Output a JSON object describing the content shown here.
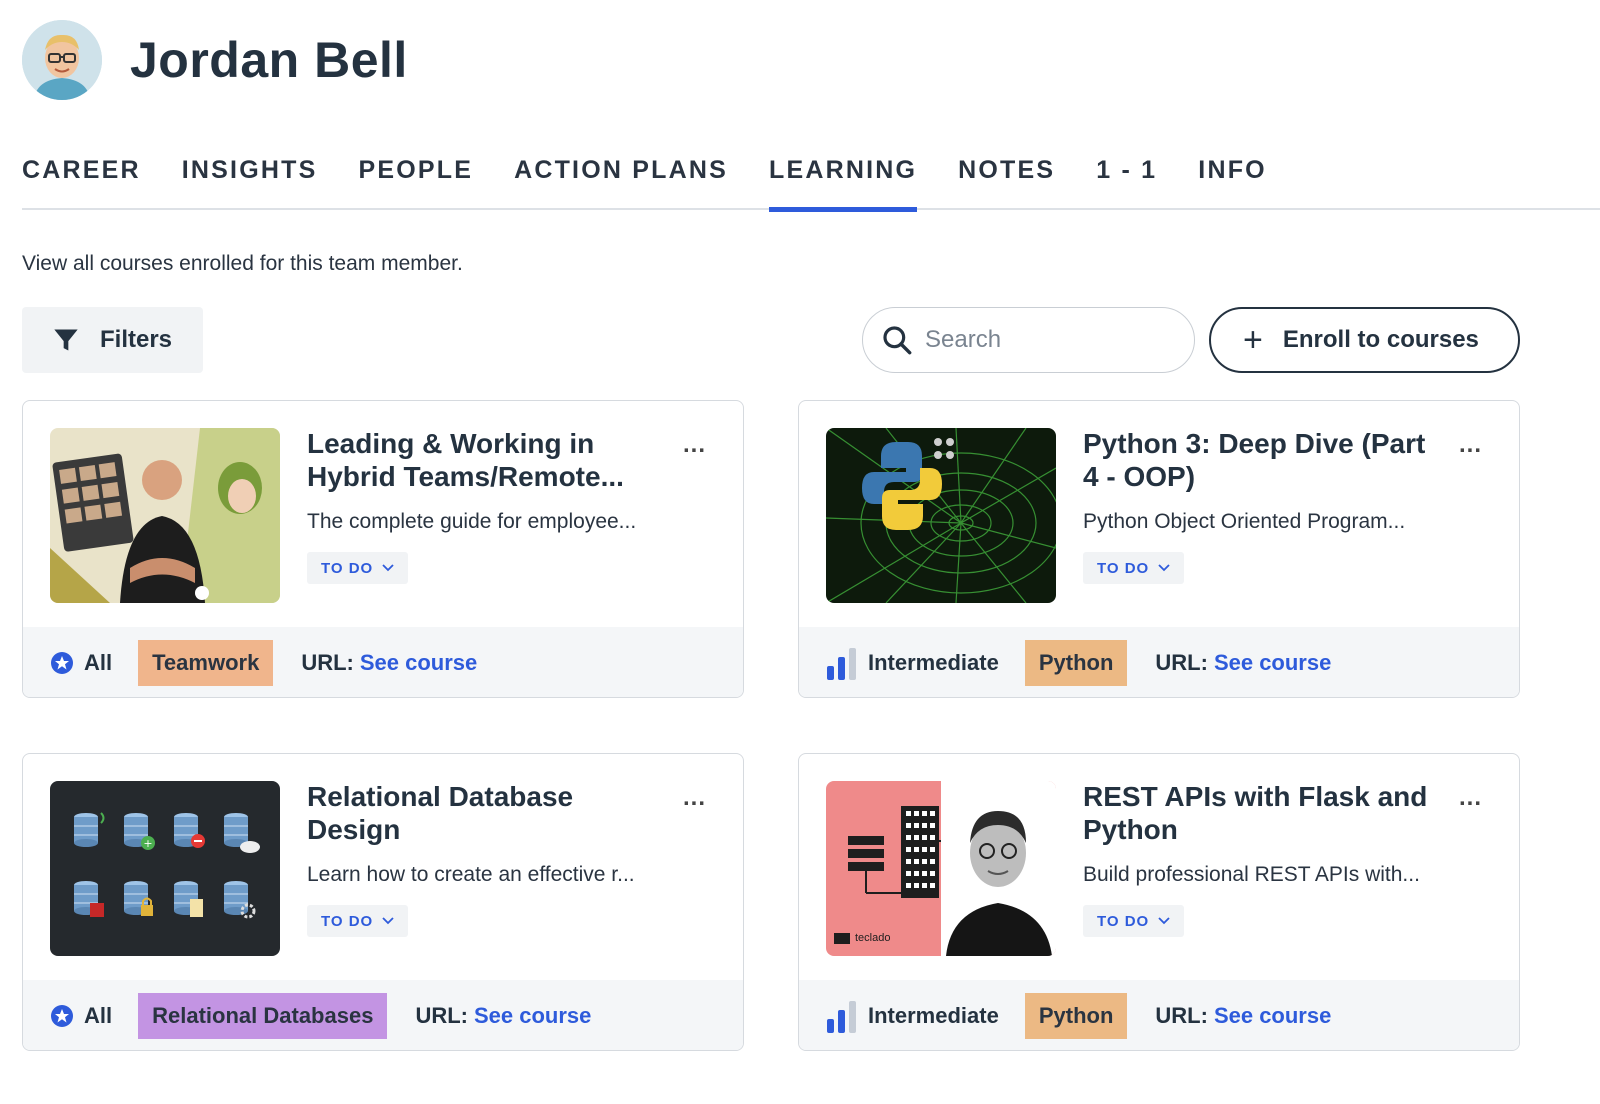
{
  "profile": {
    "name": "Jordan Bell"
  },
  "tabs": [
    {
      "label": "CAREER"
    },
    {
      "label": "INSIGHTS"
    },
    {
      "label": "PEOPLE"
    },
    {
      "label": "ACTION PLANS"
    },
    {
      "label": "LEARNING",
      "active": true
    },
    {
      "label": "NOTES"
    },
    {
      "label": "1 - 1"
    },
    {
      "label": "INFO"
    }
  ],
  "learning": {
    "description": "View all courses enrolled for this team member.",
    "filters_label": "Filters",
    "search_placeholder": "Search",
    "enroll_label": "Enroll to courses"
  },
  "colors": {
    "accent": "#2e5bdb",
    "tag_teamwork": "#f0b58c",
    "tag_python": "#ecb984",
    "tag_relational": "#c394e3"
  },
  "courses": [
    {
      "title": "Leading & Working in Hybrid Teams/Remote...",
      "subtitle": "The complete guide for employee...",
      "status": "TO DO",
      "level": "All",
      "level_icon": "star-badge-icon",
      "tag": "Teamwork",
      "url_label": "URL:",
      "url_text": "See course",
      "more": "..."
    },
    {
      "title": "Python 3: Deep Dive (Part 4 - OOP)",
      "subtitle": "Python Object Oriented Program...",
      "status": "TO DO",
      "level": "Intermediate",
      "level_icon": "bar-level-icon",
      "tag": "Python",
      "url_label": "URL:",
      "url_text": "See course",
      "more": "..."
    },
    {
      "title": "Relational Database Design",
      "subtitle": "Learn how to create an effective r...",
      "status": "TO DO",
      "level": "All",
      "level_icon": "star-badge-icon",
      "tag": "Relational Databases",
      "url_label": "URL:",
      "url_text": "See course",
      "more": "..."
    },
    {
      "title": "REST APIs with Flask and Python",
      "subtitle": "Build professional REST APIs with...",
      "status": "TO DO",
      "level": "Intermediate",
      "level_icon": "bar-level-icon",
      "tag": "Python",
      "url_label": "URL:",
      "url_text": "See course",
      "more": "...",
      "thumb_brand": "teclado"
    }
  ]
}
